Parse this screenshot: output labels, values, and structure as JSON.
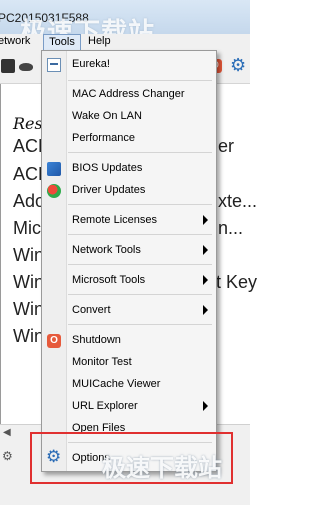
{
  "window": {
    "title": "PC2015031F588",
    "watermark": "极速下载站"
  },
  "menubar": {
    "network": "etwork",
    "tools": "Tools",
    "help": "Help"
  },
  "list": {
    "header": "Res",
    "rows": [
      {
        "label": "ACD",
        "tail": "er"
      },
      {
        "label": "ACD",
        "tail": ""
      },
      {
        "label": "Ado",
        "tail": "xte..."
      },
      {
        "label": "Mic",
        "tail": "n..."
      },
      {
        "label": "Win",
        "tail": ""
      },
      {
        "label": "Win",
        "tail": "t Key"
      },
      {
        "label": "Win",
        "tail": ""
      },
      {
        "label": "Win",
        "tail": ""
      }
    ]
  },
  "menu": {
    "eureka": "Eureka!",
    "mac": "MAC Address Changer",
    "wake": "Wake On LAN",
    "performance": "Performance",
    "bios": "BIOS Updates",
    "driver": "Driver Updates",
    "remote": "Remote Licenses",
    "network_tools": "Network Tools",
    "microsoft_tools": "Microsoft Tools",
    "convert": "Convert",
    "shutdown": "Shutdown",
    "monitor": "Monitor Test",
    "muicache": "MUICache Viewer",
    "url": "URL Explorer",
    "open_files": "Open Files",
    "options": "Options"
  },
  "icons": {
    "shutdown_glyph": "O",
    "options_glyph": "⚙",
    "toolbar_gear_glyph": "⚙",
    "toolbar_power_glyph": "O",
    "scroll_left_glyph": "◀",
    "status_gear_glyph": "⚙"
  },
  "colors": {
    "highlight": "#e03030",
    "options_icon": "#2b6cb6"
  }
}
